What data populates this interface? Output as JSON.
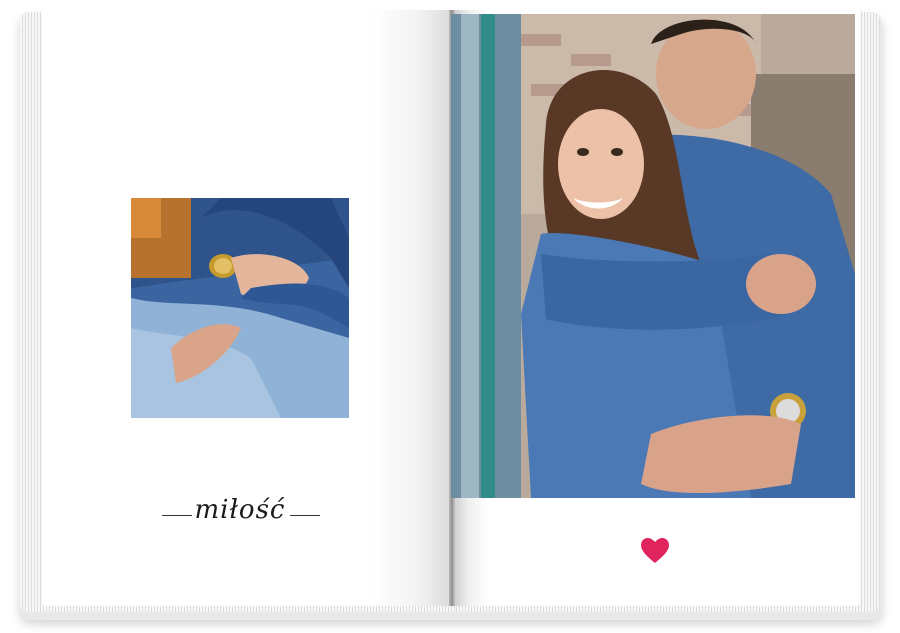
{
  "left_page": {
    "caption": "miłość",
    "photo": {
      "subject": "couple-hands-photo"
    }
  },
  "right_page": {
    "photo": {
      "subject": "couple-embrace-photo"
    },
    "ornament": "heart-icon"
  },
  "colors": {
    "heart": "#e0245e",
    "denim": "#3e6aa6",
    "page": "#ffffff"
  }
}
